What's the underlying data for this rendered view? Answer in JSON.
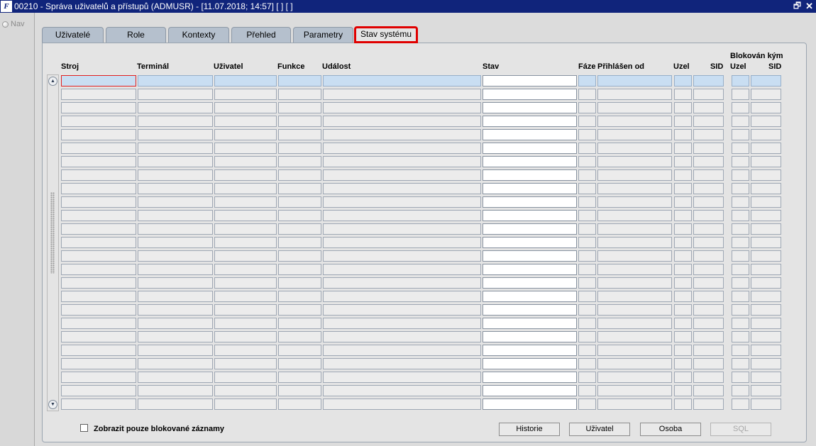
{
  "window": {
    "title": "00210 - Správa uživatelů a přístupů (ADMUSR) - [11.07.2018; 14:57] [ ] [ ]",
    "logo_text": "F",
    "restore_glyph": "🗗",
    "close_glyph": "✕"
  },
  "nav": {
    "label": "Nav"
  },
  "tabs": [
    {
      "label": "Uživatelé"
    },
    {
      "label": "Role"
    },
    {
      "label": "Kontexty"
    },
    {
      "label": "Přehled"
    },
    {
      "label": "Parametry"
    },
    {
      "label": "Stav systému",
      "active": true
    }
  ],
  "grid": {
    "group_header": "Blokován kým",
    "columns": [
      "Stroj",
      "Terminál",
      "Uživatel",
      "Funkce",
      "Událost",
      "Stav",
      "Fáze",
      "Přihlášen od",
      "Uzel",
      "SID",
      "Uzel",
      "SID"
    ],
    "row_count": 25
  },
  "scrollbar": {
    "up_glyph": "▲",
    "down_glyph": "▼"
  },
  "footer": {
    "checkbox_label": "Zobrazit pouze blokované záznamy",
    "checked": false,
    "buttons": [
      {
        "label": "Historie",
        "enabled": true
      },
      {
        "label": "Uživatel",
        "enabled": true
      },
      {
        "label": "Osoba",
        "enabled": true
      },
      {
        "label": "SQL",
        "enabled": false
      }
    ]
  }
}
